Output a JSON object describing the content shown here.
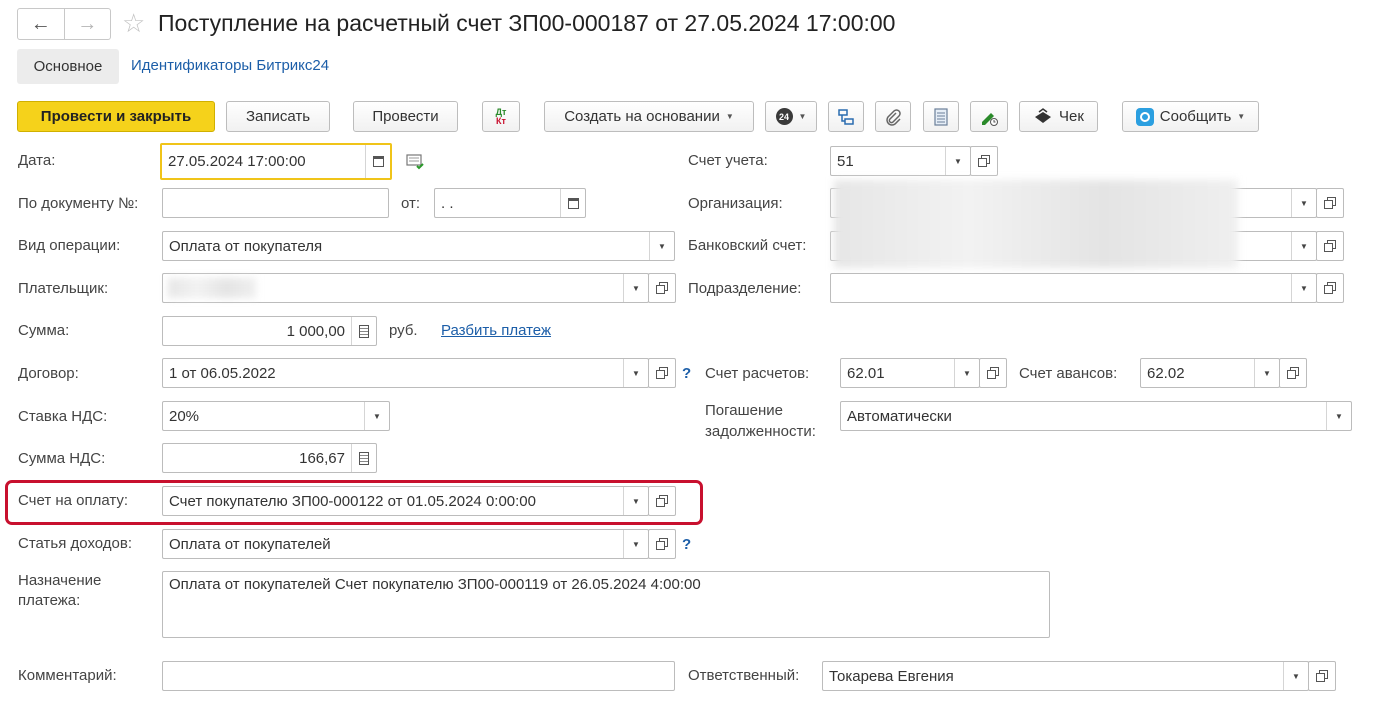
{
  "window": {
    "title": "Поступление на расчетный счет ЗП00-000187 от 27.05.2024 17:00:00",
    "back_icon": "arrow-left-icon",
    "forward_icon": "arrow-right-icon",
    "favorite_icon": "star-icon"
  },
  "tabs": [
    {
      "label": "Основное",
      "active": true
    },
    {
      "label": "Идентификаторы Битрикс24",
      "active": false
    }
  ],
  "toolbar": {
    "post_close": "Провести и закрыть",
    "save": "Записать",
    "post": "Провести",
    "dtkt_top": "Дт",
    "dtkt_bottom": "Кт",
    "create_based": "Создать на основании",
    "badge_24": "24",
    "receipt": "Чек",
    "notify": "Сообщить"
  },
  "form": {
    "date_label": "Дата:",
    "date_value": "27.05.2024 17:00:00",
    "doc_no_label": "По документу №:",
    "doc_no_value": "",
    "from_label": "от:",
    "from_value": " .  .",
    "op_type_label": "Вид операции:",
    "op_type_value": "Оплата от покупателя",
    "payer_label": "Плательщик:",
    "amount_label": "Сумма:",
    "amount_value": "1 000,00",
    "currency": "руб.",
    "split_link": "Разбить платеж",
    "contract_label": "Договор:",
    "contract_value": "1 от 06.05.2022",
    "vat_rate_label": "Ставка НДС:",
    "vat_rate_value": "20%",
    "vat_amount_label": "Сумма НДС:",
    "vat_amount_value": "166,67",
    "invoice_label": "Счет на оплату:",
    "invoice_value": "Счет покупателю ЗП00-000122 от 01.05.2024 0:00:00",
    "income_item_label": "Статья доходов:",
    "income_item_value": "Оплата от покупателей",
    "purpose_label_1": "Назначение",
    "purpose_label_2": "платежа:",
    "purpose_value": "Оплата от покупателей Счет покупателю ЗП00-000119 от 26.05.2024 4:00:00",
    "comment_label": "Комментарий:",
    "comment_value": "",
    "account_label": "Счет учета:",
    "account_value": "51",
    "org_label": "Организация:",
    "bank_label": "Банковский счет:",
    "division_label": "Подразделение:",
    "division_value": "",
    "settle_label": "Счет расчетов:",
    "settle_value": "62.01",
    "advance_label": "Счет авансов:",
    "advance_value": "62.02",
    "repay_label_1": "Погашение",
    "repay_label_2": "задолженности:",
    "repay_value": "Автоматически",
    "responsible_label": "Ответственный:",
    "responsible_value": "Токарева Евгения",
    "help_mark": "?"
  },
  "colors": {
    "primary_button": "#f5d21b",
    "link": "#1c5ea8",
    "highlight": "#c8102e",
    "focus": "#f0c419"
  }
}
